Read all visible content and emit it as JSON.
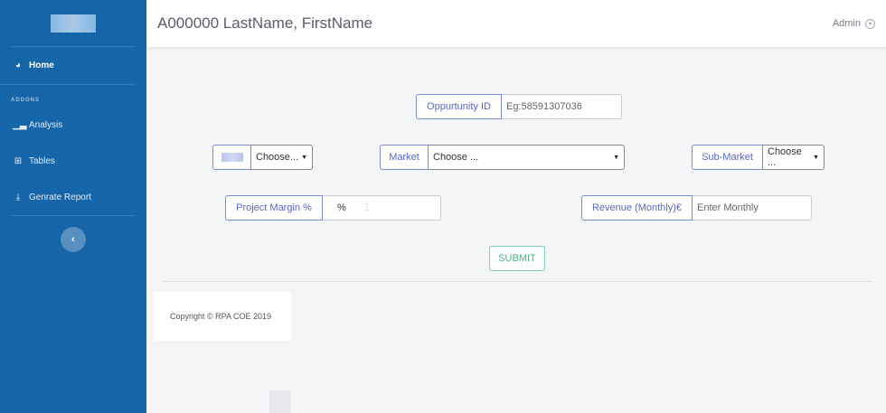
{
  "sidebar": {
    "items": [
      {
        "label": "Home",
        "icon": "dashboard-icon"
      },
      {
        "label": "Analysis",
        "icon": "chart-icon"
      },
      {
        "label": "Tables",
        "icon": "table-icon"
      },
      {
        "label": "Genrate Report",
        "icon": "download-icon"
      }
    ],
    "heading": "ADDONS",
    "collapse_icon": "‹"
  },
  "header": {
    "title": "A000000 LastName, FirstName",
    "user": "Admin"
  },
  "form": {
    "opportunity_label": "Oppurtunity ID",
    "opportunity_placeholder": "Eg:58591307036",
    "first_select_value": "Choose...",
    "market_label": "Market",
    "market_value": "Choose ...",
    "submarket_label": "Sub-Market",
    "submarket_value": "Choose ...",
    "margin_label": "Project Margin %",
    "margin_value": "%",
    "revenue_label": "Revenue (Monthly)€",
    "revenue_placeholder": "Enter Monthly",
    "submit_label": "SUBMIT"
  },
  "footer": {
    "copyright": "Copyright © RPA COE 2019"
  },
  "colors": {
    "sidebar": "#1565a8",
    "accent": "#5866c9",
    "success": "#47b585"
  }
}
